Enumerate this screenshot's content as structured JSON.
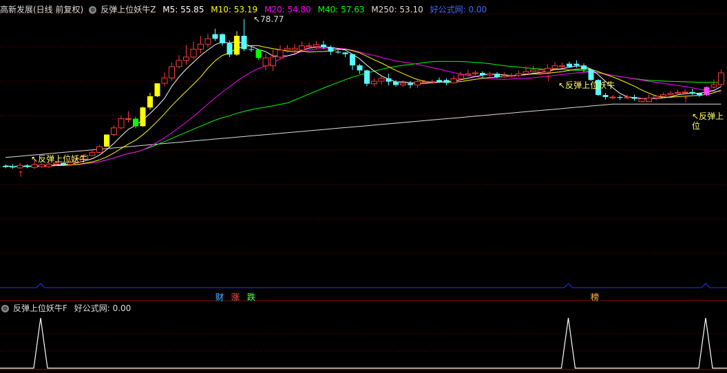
{
  "main_header": {
    "stock": "高新发展(日线 前复权)",
    "indicator": "反弹上位妖牛Z",
    "ma": [
      {
        "label": "M5: 55.85",
        "color": "#ffffff"
      },
      {
        "label": "M10: 53.19",
        "color": "#ffff00"
      },
      {
        "label": "M20: 54.80",
        "color": "#ff00ff"
      },
      {
        "label": "M40: 57.63",
        "color": "#00ff00"
      },
      {
        "label": "M250: 53.10",
        "color": "#dddddd"
      }
    ],
    "formula": "好公式网: 0.00"
  },
  "sub_header": {
    "indicator": "反弹上位妖牛F",
    "formula": "好公式网: 0.00"
  },
  "max_label": "78.77",
  "signal_label": "反弹上位妖牛",
  "signal_labels": [
    {
      "text": "反弹上位妖牛"
    },
    {
      "text": "反弹上位妖牛"
    },
    {
      "text": "反弹上位"
    }
  ],
  "event_tags": [
    {
      "text": "财",
      "color": "#44aaff"
    },
    {
      "text": "涨",
      "color": "#ff4444"
    },
    {
      "text": "跌",
      "color": "#44ff44"
    },
    {
      "text": "榜",
      "color": "#ffaa44"
    }
  ],
  "colors": {
    "up": "#ff3c3c",
    "down": "#54ffff",
    "grid": "#8b0000",
    "ma5": "#ffffff",
    "ma10": "#ffff00",
    "ma20": "#ff00ff",
    "ma40": "#00ff00",
    "ma250": "#dddddd",
    "highlight_yellow": "#ffff00",
    "highlight_green": "#00ff00",
    "highlight_magenta": "#ff44ff"
  },
  "chart_data": {
    "type": "candlestick",
    "x_unit": "trading day index",
    "y_range": [
      42,
      80
    ],
    "candles": [
      [
        43.2,
        43.5,
        43.8,
        42.9,
        "down"
      ],
      [
        43.4,
        43.1,
        43.9,
        42.8,
        "down"
      ],
      [
        43.0,
        43.6,
        44.2,
        42.8,
        "up"
      ],
      [
        43.6,
        43.2,
        43.9,
        42.9,
        "down"
      ],
      [
        43.1,
        43.8,
        44.9,
        42.7,
        "up"
      ],
      [
        43.8,
        43.3,
        44.1,
        43.0,
        "up"
      ],
      [
        43.3,
        43.9,
        44.3,
        43.0,
        "up"
      ],
      [
        43.9,
        44.2,
        44.6,
        43.6,
        "up"
      ],
      [
        44.2,
        43.8,
        44.5,
        43.5,
        "down"
      ],
      [
        43.8,
        44.4,
        44.8,
        43.6,
        "up"
      ],
      [
        44.4,
        45.1,
        45.6,
        44.1,
        "up"
      ],
      [
        45.1,
        46.0,
        46.4,
        44.8,
        "up"
      ],
      [
        46.0,
        46.7,
        47.3,
        45.8,
        "up"
      ],
      [
        46.7,
        48.1,
        48.5,
        46.5,
        "up"
      ],
      [
        48.1,
        51.0,
        51.0,
        48.0,
        "yellow"
      ],
      [
        51.0,
        52.6,
        53.2,
        50.6,
        "up"
      ],
      [
        52.6,
        54.8,
        55.6,
        52.3,
        "up"
      ],
      [
        54.8,
        54.8,
        56.6,
        53.9,
        "up"
      ],
      [
        54.8,
        53.0,
        55.3,
        52.5,
        "green"
      ],
      [
        53.0,
        57.5,
        57.7,
        52.9,
        "yellow"
      ],
      [
        57.5,
        60.2,
        61.0,
        57.0,
        "yellow"
      ],
      [
        60.2,
        63.3,
        63.3,
        60.0,
        "yellow"
      ],
      [
        63.3,
        64.6,
        65.9,
        62.6,
        "up"
      ],
      [
        64.6,
        67.3,
        68.3,
        64.0,
        "up"
      ],
      [
        67.3,
        68.8,
        70.1,
        66.9,
        "up"
      ],
      [
        68.8,
        69.6,
        72.5,
        67.8,
        "up"
      ],
      [
        69.6,
        71.5,
        73.3,
        69.0,
        "up"
      ],
      [
        71.5,
        72.7,
        74.6,
        70.5,
        "up"
      ],
      [
        72.7,
        74.0,
        75.2,
        71.9,
        "up"
      ],
      [
        74.0,
        75.1,
        76.4,
        73.5,
        "down"
      ],
      [
        75.1,
        72.9,
        75.3,
        72.3,
        "down"
      ],
      [
        72.9,
        70.2,
        73.6,
        69.6,
        "down"
      ],
      [
        70.2,
        74.7,
        75.8,
        69.9,
        "yellow"
      ],
      [
        74.7,
        71.5,
        78.77,
        71.0,
        "down"
      ],
      [
        71.5,
        71.4,
        72.2,
        70.8,
        "down"
      ],
      [
        71.4,
        69.4,
        71.6,
        69.0,
        "green"
      ],
      [
        69.4,
        67.5,
        70.4,
        66.4,
        "up"
      ],
      [
        67.5,
        69.6,
        71.4,
        66.3,
        "up"
      ],
      [
        69.6,
        71.3,
        72.4,
        69.1,
        "up"
      ],
      [
        71.3,
        71.7,
        72.5,
        70.7,
        "up"
      ],
      [
        71.7,
        71.3,
        72.7,
        70.6,
        "up"
      ],
      [
        71.3,
        72.3,
        73.3,
        70.8,
        "up"
      ],
      [
        72.3,
        72.1,
        73.1,
        71.5,
        "up"
      ],
      [
        72.1,
        72.6,
        73.5,
        71.5,
        "up"
      ],
      [
        72.6,
        71.9,
        73.5,
        71.5,
        "down"
      ],
      [
        71.9,
        70.9,
        72.4,
        70.1,
        "down"
      ],
      [
        70.9,
        70.7,
        71.3,
        70.4,
        "down"
      ],
      [
        70.7,
        70.3,
        70.8,
        69.6,
        "down"
      ],
      [
        70.3,
        67.6,
        70.3,
        66.5,
        "down"
      ],
      [
        67.6,
        66.4,
        68.0,
        65.6,
        "down"
      ],
      [
        66.4,
        63.2,
        66.6,
        62.6,
        "down"
      ],
      [
        63.2,
        63.8,
        64.5,
        62.6,
        "up"
      ],
      [
        63.8,
        64.5,
        65.0,
        63.0,
        "up"
      ],
      [
        64.5,
        63.7,
        65.6,
        62.8,
        "down"
      ],
      [
        63.7,
        62.9,
        64.1,
        62.5,
        "down"
      ],
      [
        62.9,
        63.3,
        64.0,
        62.5,
        "up"
      ],
      [
        63.3,
        62.9,
        63.9,
        62.1,
        "down"
      ],
      [
        62.9,
        63.7,
        64.5,
        62.3,
        "up"
      ],
      [
        63.7,
        63.6,
        64.1,
        63.2,
        "up"
      ],
      [
        63.6,
        63.7,
        64.2,
        63.1,
        "up"
      ],
      [
        63.7,
        64.1,
        64.7,
        63.4,
        "down"
      ],
      [
        64.1,
        63.4,
        64.5,
        62.9,
        "down"
      ],
      [
        63.4,
        64.4,
        65.2,
        63.2,
        "up"
      ],
      [
        64.4,
        65.3,
        66.1,
        64.0,
        "up"
      ],
      [
        65.3,
        65.6,
        66.6,
        65.0,
        "up"
      ],
      [
        65.6,
        65.8,
        66.3,
        65.1,
        "up"
      ],
      [
        65.8,
        65.3,
        66.2,
        64.7,
        "down"
      ],
      [
        65.3,
        65.6,
        66.1,
        64.9,
        "up"
      ],
      [
        65.6,
        64.8,
        66.0,
        64.5,
        "down"
      ],
      [
        64.8,
        65.1,
        65.9,
        64.6,
        "up"
      ],
      [
        65.1,
        65.2,
        65.8,
        64.7,
        "up"
      ],
      [
        65.2,
        65.6,
        66.3,
        64.8,
        "up"
      ],
      [
        65.6,
        66.1,
        67.4,
        65.3,
        "up"
      ],
      [
        66.1,
        66.5,
        67.5,
        65.6,
        "up"
      ],
      [
        66.5,
        66.0,
        66.9,
        65.3,
        "up"
      ],
      [
        66.0,
        66.9,
        67.9,
        65.8,
        "up"
      ],
      [
        66.9,
        67.5,
        68.4,
        66.6,
        "up"
      ],
      [
        67.5,
        67.3,
        68.3,
        66.9,
        "up"
      ],
      [
        67.3,
        68.0,
        68.5,
        67.0,
        "down"
      ],
      [
        68.0,
        67.6,
        68.8,
        67.0,
        "down"
      ],
      [
        67.6,
        66.6,
        68.1,
        66.0,
        "down"
      ],
      [
        66.6,
        64.1,
        66.8,
        63.9,
        "down"
      ],
      [
        64.1,
        60.5,
        64.3,
        60.3,
        "down"
      ],
      [
        60.5,
        60.0,
        61.0,
        59.4,
        "down"
      ],
      [
        60.0,
        60.0,
        60.5,
        59.5,
        "up"
      ],
      [
        60.0,
        59.8,
        60.4,
        59.3,
        "down"
      ],
      [
        59.8,
        60.0,
        60.6,
        59.5,
        "up"
      ],
      [
        60.0,
        59.6,
        60.6,
        59.1,
        "down"
      ],
      [
        59.6,
        58.9,
        59.8,
        58.7,
        "up"
      ],
      [
        58.9,
        59.8,
        60.6,
        58.8,
        "up"
      ],
      [
        59.8,
        60.2,
        60.5,
        59.3,
        "up"
      ],
      [
        60.2,
        60.6,
        61.1,
        59.8,
        "up"
      ],
      [
        60.6,
        60.9,
        61.5,
        60.4,
        "up"
      ],
      [
        60.9,
        61.1,
        61.8,
        60.7,
        "up"
      ],
      [
        61.1,
        61.2,
        61.9,
        60.7,
        "up"
      ],
      [
        61.2,
        60.9,
        62.0,
        60.5,
        "down"
      ],
      [
        60.9,
        60.5,
        61.1,
        60.1,
        "down"
      ],
      [
        60.5,
        62.4,
        62.6,
        60.2,
        "magenta"
      ],
      [
        62.4,
        63.0,
        64.2,
        62.0,
        "up"
      ],
      [
        63.0,
        65.8,
        66.6,
        62.6,
        "up"
      ]
    ],
    "signals": [
      2,
      75,
      94
    ],
    "sub_indicator_peaks": [
      2,
      75,
      94
    ]
  }
}
